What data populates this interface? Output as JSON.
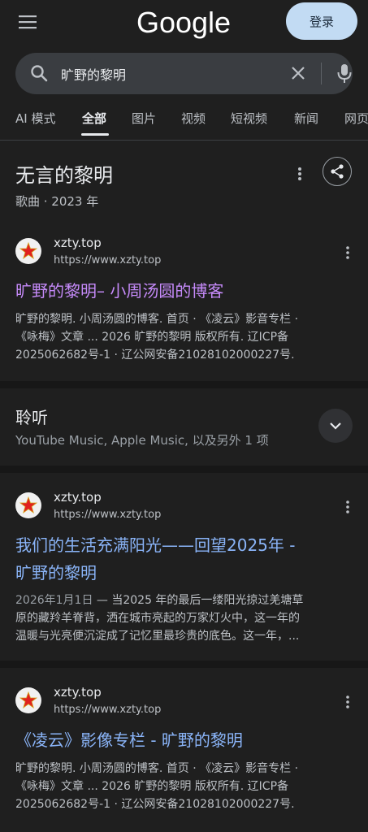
{
  "header": {
    "logo_text": "Google",
    "signin_label": "登录"
  },
  "search": {
    "query": "旷野的黎明"
  },
  "tabs": [
    {
      "label": "AI 模式"
    },
    {
      "label": "全部"
    },
    {
      "label": "图片"
    },
    {
      "label": "视频"
    },
    {
      "label": "短视频"
    },
    {
      "label": "新闻"
    },
    {
      "label": "网页"
    }
  ],
  "knowledge": {
    "title": "无言的黎明",
    "subtitle": "歌曲 · 2023 年"
  },
  "results": [
    {
      "site_name": "xzty.top",
      "url": "https://www.xzty.top",
      "title": "旷野的黎明– 小周汤圆的博客",
      "snippet_lines": [
        "旷野的黎明. 小周汤圆的博客. 首页 · 《凌云》影音专栏 ·",
        "《咏梅》文章 ... 2026 旷野的黎明 版权所有. 辽ICP备",
        "2025062682号-1 · 辽公网安备21028102000227号."
      ]
    },
    {
      "site_name": "xzty.top",
      "url": "https://www.xzty.top",
      "title_lines": [
        "我们的生活充满阳光——回望2025年 -",
        "旷野的黎明"
      ],
      "date": "2026年1月1日",
      "snippet_lines": [
        " — 当2025 年的最后一缕阳光掠过羌塘草",
        "原的藏羚羊脊背，洒在城市亮起的万家灯火中，这一年的",
        "温暖与光亮便沉淀成了记忆里最珍贵的底色。这一年，..."
      ]
    },
    {
      "site_name": "xzty.top",
      "url": "https://www.xzty.top",
      "title": "《凌云》影像专栏 - 旷野的黎明",
      "snippet_lines": [
        "旷野的黎明. 小周汤圆的博客. 首页 · 《凌云》影音专栏 ·",
        "《咏梅》文章 ... 2026 旷野的黎明 版权所有. 辽ICP备",
        "2025062682号-1 · 辽公网安备21028102000227号."
      ]
    }
  ],
  "listen": {
    "title": "聆听",
    "subtitle": "YouTube Music, Apple Music, 以及另外 1 项"
  },
  "icons": {
    "menu": "hamburger-menu-icon",
    "search": "search-icon",
    "clear": "close-icon",
    "mic": "microphone-icon",
    "more": "more-vert-icon",
    "share": "share-icon",
    "expand": "chevron-down-icon",
    "favicon": "red-star-favicon"
  },
  "colors": {
    "background": "#1f1f1f",
    "visited_link": "#c58af9",
    "link": "#8ab4f8",
    "signin_bg": "#c2dbf3"
  }
}
